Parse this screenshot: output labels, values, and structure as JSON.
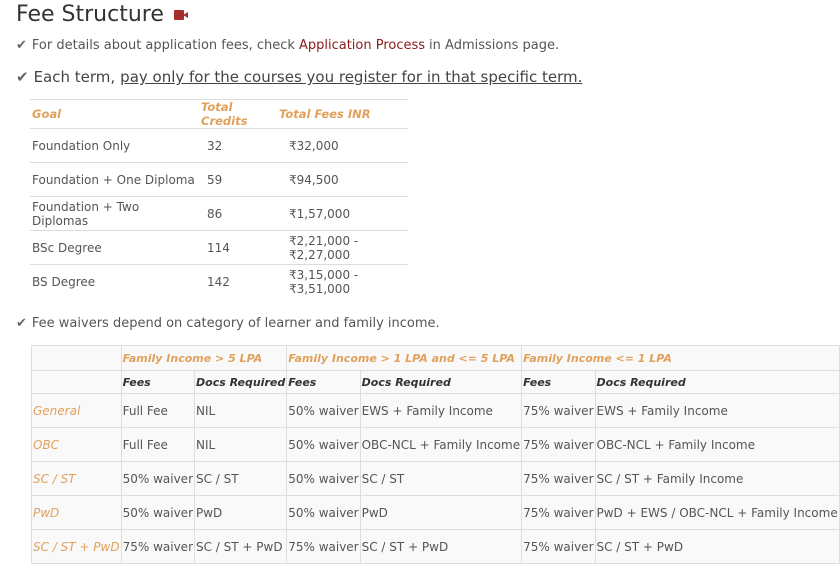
{
  "page": {
    "title": "Fee Structure",
    "title_icon": "video-icon",
    "note1": {
      "pre": "For details about application fees, check",
      "link": "Application Process",
      "post": "in Admissions page."
    },
    "note2": {
      "pre": "Each term,",
      "underlined": "pay only for the courses you register for in that specific term."
    },
    "note3": "Fee waivers depend on category of learner and family income."
  },
  "fees_table": {
    "headers": [
      "Goal",
      "Total Credits",
      "Total Fees INR"
    ],
    "rows": [
      [
        "Foundation Only",
        "32",
        "₹32,000"
      ],
      [
        "Foundation + One Diploma",
        "59",
        "₹94,500"
      ],
      [
        "Foundation + Two Diplomas",
        "86",
        "₹1,57,000"
      ],
      [
        "BSc Degree",
        "114",
        "₹2,21,000 - ₹2,27,000"
      ],
      [
        "BS Degree",
        "142",
        "₹3,15,000 - ₹3,51,000"
      ]
    ]
  },
  "waiver_table": {
    "group_headers": [
      "Family Income > 5 LPA",
      "Family Income > 1 LPA and <= 5 LPA",
      "Family Income <= 1 LPA"
    ],
    "sub_headers": [
      "Fees",
      "Docs Required",
      "Fees",
      "Docs Required",
      "Fees",
      "Docs Required"
    ],
    "rows": [
      {
        "category": "General",
        "cells": [
          "Full Fee",
          "NIL",
          "50% waiver",
          "EWS + Family Income",
          "75% waiver",
          "EWS + Family Income"
        ]
      },
      {
        "category": "OBC",
        "cells": [
          "Full Fee",
          "NIL",
          "50% waiver",
          "OBC-NCL + Family Income",
          "75% waiver",
          "OBC-NCL + Family Income"
        ]
      },
      {
        "category": "SC / ST",
        "cells": [
          "50% waiver",
          "SC / ST",
          "50% waiver",
          "SC / ST",
          "75% waiver",
          "SC / ST + Family Income"
        ]
      },
      {
        "category": "PwD",
        "cells": [
          "50% waiver",
          "PwD",
          "50% waiver",
          "PwD",
          "75% waiver",
          "PwD + EWS / OBC-NCL + Family Income"
        ]
      },
      {
        "category": "SC / ST + PwD",
        "cells": [
          "75% waiver",
          "SC / ST + PwD",
          "75% waiver",
          "SC / ST + PwD",
          "75% waiver",
          "SC / ST + PwD"
        ]
      }
    ]
  },
  "colors": {
    "accent": "#e1a15b",
    "link": "#8b1a1a",
    "icon": "#a72c2c"
  }
}
